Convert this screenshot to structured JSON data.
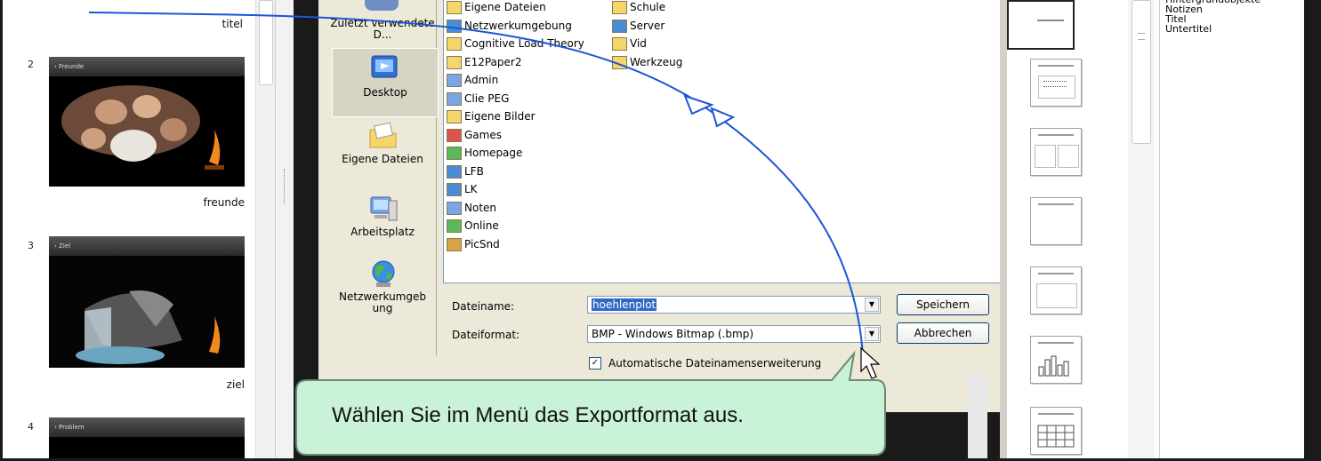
{
  "slides": [
    {
      "number": "",
      "label": "titel"
    },
    {
      "number": "2",
      "header": "› Freunde",
      "label": "freunde"
    },
    {
      "number": "3",
      "header": "› Ziel",
      "label": "ziel"
    },
    {
      "number": "4",
      "header": "› Problem",
      "label": ""
    }
  ],
  "places": {
    "recent": "Zuletzt verwendete D...",
    "desktop": "Desktop",
    "my_docs": "Eigene Dateien",
    "my_computer": "Arbeitsplatz",
    "network": "Netzwerkumgeb ung"
  },
  "files_col1": [
    "Eigene Dateien",
    "Netzwerkumgebung",
    "Cognitive Load Theory",
    "E12Paper2",
    "Admin",
    "Clie PEG",
    "Eigene Bilder",
    "Games",
    "Homepage",
    "LFB",
    "LK",
    "Noten",
    "Online",
    "PicSnd"
  ],
  "files_col2": [
    "Schule",
    "Server",
    "Vid",
    "Werkzeug"
  ],
  "form": {
    "filename_label": "Dateiname:",
    "filename_value": "hoehlenplot",
    "format_label": "Dateiformat:",
    "format_value": "BMP - Windows Bitmap (.bmp)",
    "auto_ext_label": "Automatische Dateinamenserweiterung",
    "auto_ext_checked": true,
    "save_label": "Speichern",
    "cancel_label": "Abbrechen"
  },
  "styles": [
    "Hintergrundobjekte",
    "Notizen",
    "Titel",
    "Untertitel"
  ],
  "callout_text": "Wählen Sie im Menü das Exportformat aus.",
  "colors": {
    "callout_fill": "#c9f2d8",
    "arrow": "#1a56d6",
    "dialog_bg": "#ece9d8"
  }
}
